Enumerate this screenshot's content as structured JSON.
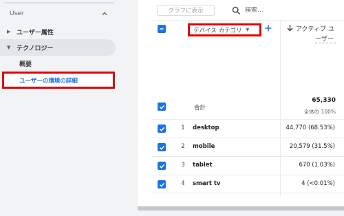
{
  "sidebar": {
    "section_label": "User",
    "categories": [
      {
        "label": "ユーザー属性"
      },
      {
        "label": "テクノロジー"
      }
    ],
    "sub_items": [
      {
        "label": "概要"
      },
      {
        "label": "ユーザーの環境の詳細"
      }
    ]
  },
  "toolbar": {
    "graph_button_label": "グラフに表示",
    "search_placeholder": "検索..."
  },
  "table": {
    "dimension_header": "デバイス カテゴリ",
    "metric_header_line1": "アクティブ ユ",
    "metric_header_line2": "ーザー",
    "total": {
      "label": "合計",
      "value": "65,330",
      "sub": "全体の 100%"
    },
    "rows": [
      {
        "index": "1",
        "dimension": "desktop",
        "value": "44,770 (68.53%)"
      },
      {
        "index": "2",
        "dimension": "mobile",
        "value": "20,579 (31.5%)"
      },
      {
        "index": "3",
        "dimension": "tablet",
        "value": "670 (1.03%)"
      },
      {
        "index": "4",
        "dimension": "smart tv",
        "value": "4 (<0.01%)"
      }
    ]
  },
  "colors": {
    "accent": "#1a73e8",
    "highlight_border": "#e30000"
  }
}
